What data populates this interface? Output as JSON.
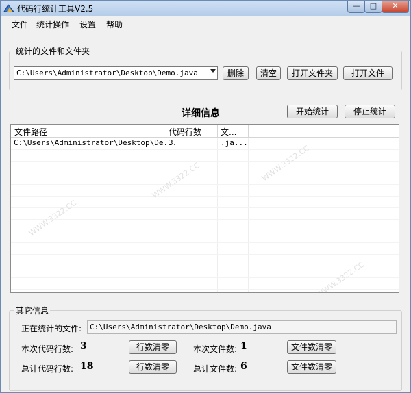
{
  "window": {
    "title": "代码行统计工具V2.5"
  },
  "menu": [
    "文件",
    "统计操作",
    "设置",
    "帮助"
  ],
  "files_group": {
    "label": "统计的文件和文件夹",
    "selected_path": "C:\\Users\\Administrator\\Desktop\\Demo.java",
    "delete_label": "删除",
    "clear_label": "清空",
    "open_folder_label": "打开文件夹",
    "open_file_label": "打开文件"
  },
  "details": {
    "title": "详细信息",
    "start_label": "开始统计",
    "stop_label": "停止统计",
    "columns": [
      "文件路径",
      "代码行数",
      "文..."
    ],
    "rows": [
      [
        "C:\\Users\\Administrator\\Desktop\\De...",
        "3",
        ".ja..."
      ]
    ]
  },
  "other": {
    "label": "其它信息",
    "current_file_label": "正在统计的文件:",
    "current_file": "C:\\Users\\Administrator\\Desktop\\Demo.java",
    "this_lines_label": "本次代码行数:",
    "this_lines": "3",
    "this_files_label": "本次文件数:",
    "this_files": "1",
    "total_lines_label": "总计代码行数:",
    "total_lines": "18",
    "total_files_label": "总计文件数:",
    "total_files": "6",
    "reset_lines_label": "行数清零",
    "reset_files_label": "文件数清零"
  },
  "watermark": "WWW.3322.CC",
  "colors": {
    "titlebar": "#b5cde9",
    "close": "#c7432c"
  }
}
